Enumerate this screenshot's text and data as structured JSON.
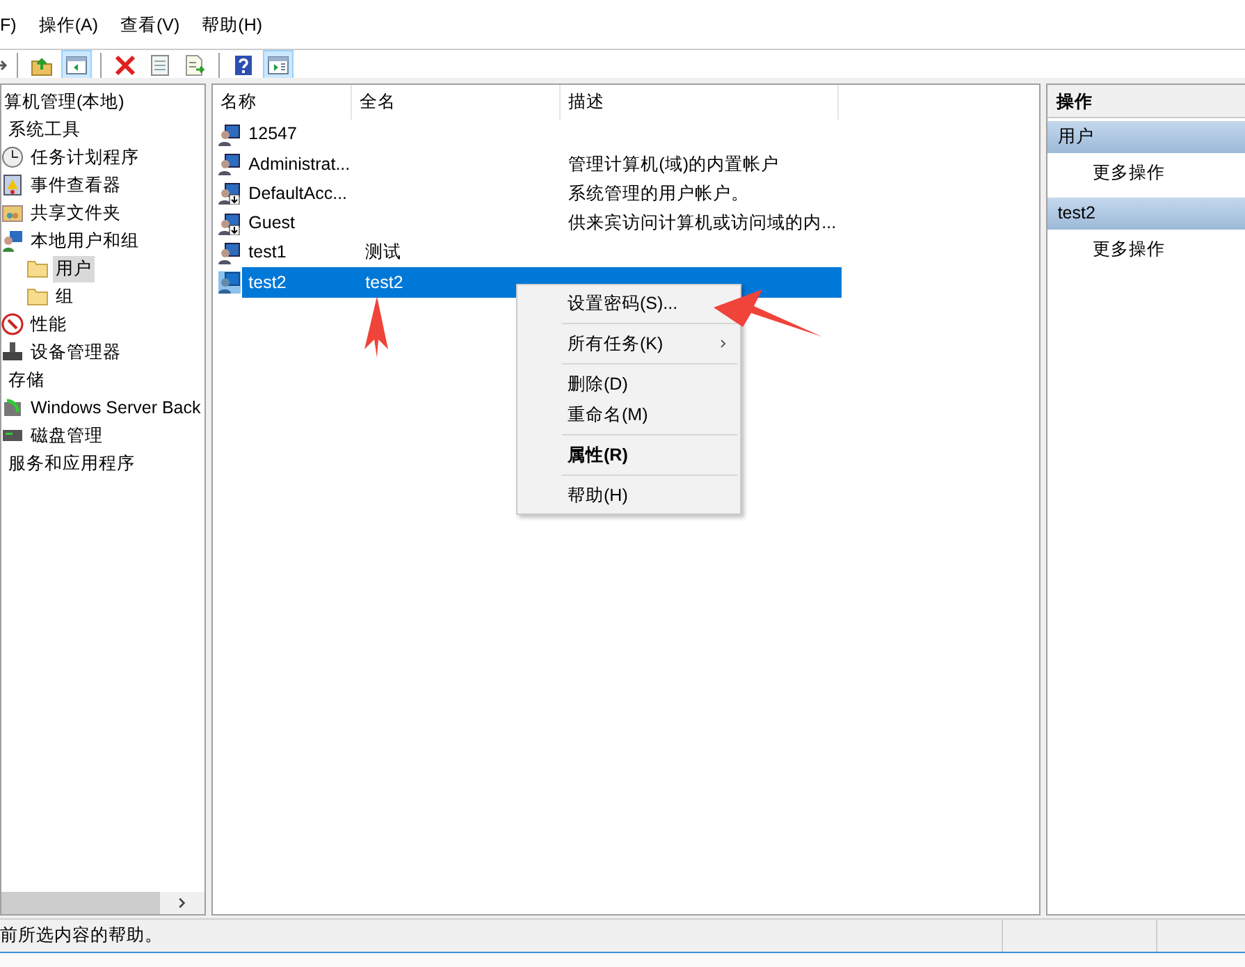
{
  "menu_bar": [
    {
      "label": "F)"
    },
    {
      "label": "操作(A)"
    },
    {
      "label": "查看(V)"
    },
    {
      "label": "帮助(H)"
    }
  ],
  "toolbar": [
    {
      "kind": "back",
      "pressed": false
    },
    {
      "kind": "sep"
    },
    {
      "kind": "up",
      "pressed": false
    },
    {
      "kind": "tree",
      "pressed": true
    },
    {
      "kind": "sep"
    },
    {
      "kind": "delete",
      "pressed": false
    },
    {
      "kind": "properties",
      "pressed": false
    },
    {
      "kind": "export",
      "pressed": false
    },
    {
      "kind": "sep"
    },
    {
      "kind": "help",
      "pressed": false
    },
    {
      "kind": "actionpane",
      "pressed": true
    }
  ],
  "tree": [
    {
      "label": "算机管理(本地)",
      "selected": false,
      "children": [
        {
          "label": "系统工具",
          "selected": false,
          "children": [
            {
              "label": "任务计划程序",
              "kind": "clock",
              "selected": false
            },
            {
              "label": "事件查看器",
              "kind": "log",
              "selected": false
            },
            {
              "label": "共享文件夹",
              "kind": "share",
              "selected": false
            },
            {
              "label": "本地用户和组",
              "kind": "users",
              "selected": false,
              "children": [
                {
                  "label": "用户",
                  "kind": "folder",
                  "selected": true
                },
                {
                  "label": "组",
                  "kind": "folder",
                  "selected": false
                }
              ]
            },
            {
              "label": "性能",
              "kind": "gauge",
              "selected": false
            },
            {
              "label": "设备管理器",
              "kind": "device",
              "selected": false
            }
          ]
        },
        {
          "label": "存储",
          "selected": false,
          "children": [
            {
              "label": "Windows Server Back",
              "kind": "backup",
              "selected": false
            },
            {
              "label": "磁盘管理",
              "kind": "disk",
              "selected": false
            }
          ]
        },
        {
          "label": "服务和应用程序",
          "selected": false
        }
      ]
    }
  ],
  "table": {
    "columns": [
      "名称",
      "全名",
      "描述"
    ],
    "rows": [
      {
        "name": "12547",
        "full_name": "",
        "description": "",
        "disabled": false,
        "selected": false
      },
      {
        "name": "Administrat...",
        "full_name": "",
        "description": "管理计算机(域)的内置帐户",
        "disabled": false,
        "selected": false
      },
      {
        "name": "DefaultAcc...",
        "full_name": "",
        "description": "系统管理的用户帐户。",
        "disabled": true,
        "selected": false
      },
      {
        "name": "Guest",
        "full_name": "",
        "description": "供来宾访问计算机或访问域的内...",
        "disabled": true,
        "selected": false
      },
      {
        "name": "test1",
        "full_name": "测试",
        "description": "",
        "disabled": false,
        "selected": false
      },
      {
        "name": "test2",
        "full_name": "test2",
        "description": "",
        "disabled": false,
        "selected": true
      }
    ]
  },
  "context_menu": [
    {
      "kind": "item",
      "label": "设置密码(S)...",
      "submenu": false,
      "default": false
    },
    {
      "kind": "separator"
    },
    {
      "kind": "item",
      "label": "所有任务(K)",
      "submenu": true,
      "default": false
    },
    {
      "kind": "separator"
    },
    {
      "kind": "item",
      "label": "删除(D)",
      "submenu": false,
      "default": false
    },
    {
      "kind": "item",
      "label": "重命名(M)",
      "submenu": false,
      "default": false
    },
    {
      "kind": "separator"
    },
    {
      "kind": "item",
      "label": "属性(R)",
      "submenu": false,
      "default": true
    },
    {
      "kind": "separator"
    },
    {
      "kind": "item",
      "label": "帮助(H)",
      "submenu": false,
      "default": false
    }
  ],
  "actions": {
    "title": "操作",
    "sections": [
      {
        "title": "用户",
        "items": [
          "更多操作"
        ]
      },
      {
        "title": "test2",
        "items": [
          "更多操作"
        ]
      }
    ]
  },
  "status_bar": {
    "text": "前所选内容的帮助。"
  }
}
